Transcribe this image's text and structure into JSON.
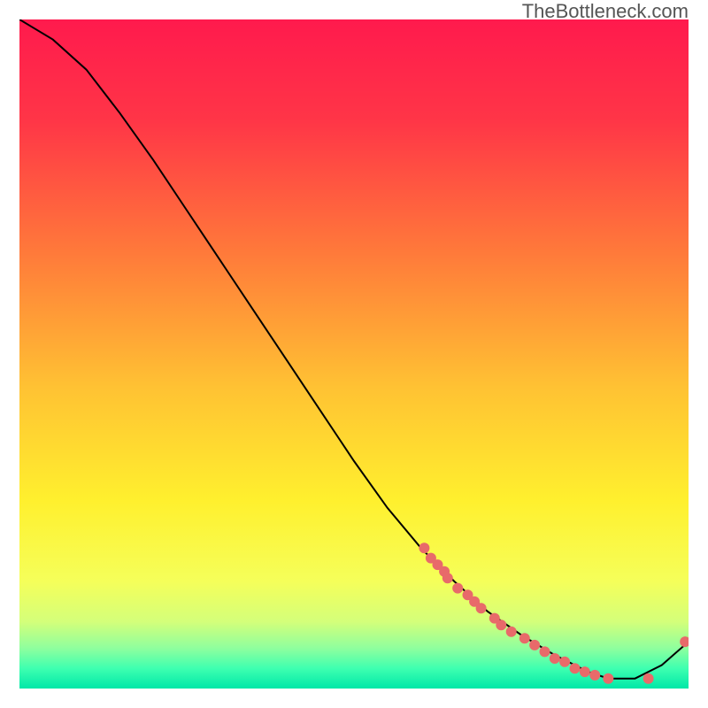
{
  "watermark": "TheBottleneck.com",
  "chart_data": {
    "type": "line",
    "title": "",
    "xlabel": "",
    "ylabel": "",
    "xlim": [
      0,
      100
    ],
    "ylim": [
      0,
      100
    ],
    "note": "Axes unlabeled; values are normalized 0-100 estimates from pixel positions. Curve descends from top-left, reaches minimum near x≈88, then rises at far right.",
    "curve": {
      "x": [
        0,
        5,
        10,
        15,
        20,
        25,
        30,
        35,
        40,
        45,
        50,
        55,
        60,
        65,
        70,
        75,
        80,
        85,
        88,
        92,
        96,
        100
      ],
      "y": [
        100,
        97,
        92.5,
        86,
        79,
        71.5,
        64,
        56.5,
        49,
        41.5,
        34,
        27,
        21,
        16,
        11.5,
        8,
        5,
        2.5,
        1.5,
        1.5,
        3.5,
        7
      ]
    },
    "marker_points": {
      "x": [
        60.5,
        61.5,
        62.5,
        63.5,
        64,
        65.5,
        67,
        68,
        69,
        71,
        72,
        73.5,
        75.5,
        77,
        78.5,
        80,
        81.5,
        83,
        84.5,
        86,
        88,
        94,
        99.5
      ],
      "y": [
        21,
        19.5,
        18.5,
        17.5,
        16.5,
        15,
        14,
        13,
        12,
        10.5,
        9.5,
        8.5,
        7.5,
        6.5,
        5.5,
        4.5,
        4,
        3,
        2.5,
        2,
        1.5,
        1.5,
        7
      ]
    },
    "gradient_stops": [
      {
        "offset": 0.0,
        "color": "#ff1a4d"
      },
      {
        "offset": 0.15,
        "color": "#ff3547"
      },
      {
        "offset": 0.35,
        "color": "#ff7a3a"
      },
      {
        "offset": 0.55,
        "color": "#ffc233"
      },
      {
        "offset": 0.72,
        "color": "#fff02e"
      },
      {
        "offset": 0.84,
        "color": "#f5ff5a"
      },
      {
        "offset": 0.9,
        "color": "#d4ff7a"
      },
      {
        "offset": 0.94,
        "color": "#8eff9e"
      },
      {
        "offset": 0.97,
        "color": "#3effb0"
      },
      {
        "offset": 1.0,
        "color": "#00e8a8"
      }
    ],
    "marker_color": "#e86a6a",
    "line_color": "#000000"
  }
}
